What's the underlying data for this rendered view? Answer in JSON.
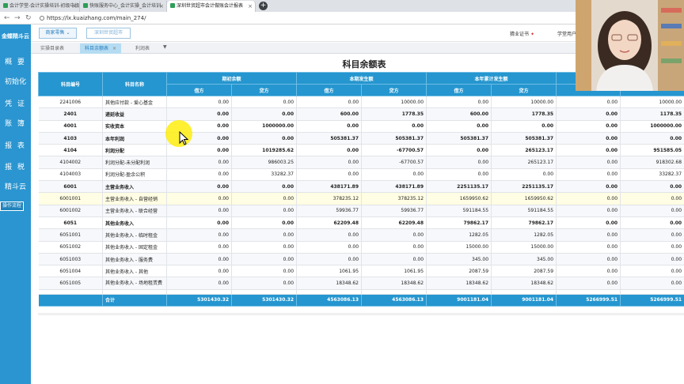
{
  "browser": {
    "tabs": [
      {
        "label": "会计学堂-会计实操培训-初级中级"
      },
      {
        "label": "快账服务中心_会计实操_会计培训"
      },
      {
        "label": "深圳世贸超市会计做账会计报表"
      }
    ],
    "url": "https://lx.kuaizhang.com/main_274/"
  },
  "sidebar": {
    "logo": "金蝶精斗云",
    "items": [
      "概 要",
      "初始化",
      "凭 证",
      "账 簿",
      "报 表",
      "报 税",
      "精斗云"
    ],
    "op_flow": "操作流程"
  },
  "header": {
    "dropdown": "商家零售",
    "company": "深圳世贸超市",
    "cert": "猜业证书",
    "user": "学堂用户"
  },
  "subtabs": [
    {
      "label": "实操目录表"
    },
    {
      "label": "科目余额表"
    },
    {
      "label": "利润表"
    }
  ],
  "report": {
    "title": "科目余额表",
    "headers": {
      "code": "科目编号",
      "name": "科目名称",
      "opening": "期初余额",
      "current": "本期发生额",
      "ytd": "本年累计发生额",
      "debit": "借方",
      "credit": "贷方"
    },
    "rows": [
      {
        "code": "2241006",
        "name": "其他应付款 - 爱心基金",
        "v": [
          "0.00",
          "0.00",
          "0.00",
          "10000.00",
          "0.00",
          "10000.00",
          "0.00",
          "10000.00"
        ]
      },
      {
        "code": "2401",
        "name": "递延收益",
        "v": [
          "0.00",
          "0.00",
          "600.00",
          "1778.35",
          "600.00",
          "1778.35",
          "0.00",
          "1178.35"
        ]
      },
      {
        "code": "4001",
        "name": "实收资本",
        "v": [
          "0.00",
          "1000000.00",
          "0.00",
          "0.00",
          "0.00",
          "0.00",
          "0.00",
          "1000000.00"
        ]
      },
      {
        "code": "4103",
        "name": "本年利润",
        "v": [
          "0.00",
          "0.00",
          "505381.37",
          "505381.37",
          "505381.37",
          "505381.37",
          "0.00",
          "0.00"
        ]
      },
      {
        "code": "4104",
        "name": "利润分配",
        "v": [
          "0.00",
          "1019285.62",
          "0.00",
          "-67700.57",
          "0.00",
          "265123.17",
          "0.00",
          "951585.05"
        ]
      },
      {
        "code": "4104002",
        "name": "利润分配-未分配利润",
        "v": [
          "0.00",
          "986003.25",
          "0.00",
          "-67700.57",
          "0.00",
          "265123.17",
          "0.00",
          "918302.68"
        ]
      },
      {
        "code": "4104003",
        "name": "利润分配-盈余公积",
        "v": [
          "0.00",
          "33282.37",
          "0.00",
          "0.00",
          "0.00",
          "0.00",
          "0.00",
          "33282.37"
        ]
      },
      {
        "code": "6001",
        "name": "主营业务收入",
        "v": [
          "0.00",
          "0.00",
          "438171.89",
          "438171.89",
          "2251135.17",
          "2251135.17",
          "0.00",
          "0.00"
        ]
      },
      {
        "code": "6001001",
        "name": "主营业务收入 - 自营经销",
        "v": [
          "0.00",
          "0.00",
          "378235.12",
          "378235.12",
          "1659950.62",
          "1659950.62",
          "0.00",
          "0.00"
        ]
      },
      {
        "code": "6001002",
        "name": "主营业务收入 - 联合经营",
        "v": [
          "0.00",
          "0.00",
          "59936.77",
          "59936.77",
          "591184.55",
          "591184.55",
          "0.00",
          "0.00"
        ]
      },
      {
        "code": "6051",
        "name": "其他业务收入",
        "v": [
          "0.00",
          "0.00",
          "62209.48",
          "62209.48",
          "79862.17",
          "79862.17",
          "0.00",
          "0.00"
        ]
      },
      {
        "code": "6051001",
        "name": "其他业务收入 - 临时租金",
        "v": [
          "0.00",
          "0.00",
          "0.00",
          "0.00",
          "1282.05",
          "1282.05",
          "0.00",
          "0.00"
        ]
      },
      {
        "code": "6051002",
        "name": "其他业务收入 - 固定租金",
        "v": [
          "0.00",
          "0.00",
          "0.00",
          "0.00",
          "15000.00",
          "15000.00",
          "0.00",
          "0.00"
        ]
      },
      {
        "code": "6051003",
        "name": "其他业务收入 - 服务费",
        "v": [
          "0.00",
          "0.00",
          "0.00",
          "0.00",
          "345.00",
          "345.00",
          "0.00",
          "0.00"
        ]
      },
      {
        "code": "6051004",
        "name": "其他业务收入 - 其他",
        "v": [
          "0.00",
          "0.00",
          "1061.95",
          "1061.95",
          "2087.59",
          "2087.59",
          "0.00",
          "0.00"
        ]
      },
      {
        "code": "6051005",
        "name": "其他业务收入 - 场地租赁费",
        "v": [
          "0.00",
          "0.00",
          "18348.62",
          "18348.62",
          "18348.62",
          "18348.62",
          "0.00",
          "0.00"
        ]
      }
    ],
    "total": {
      "label": "合计",
      "v": [
        "5301430.32",
        "5301430.32",
        "4563086.13",
        "4563086.13",
        "9001181.04",
        "9001181.04",
        "5266999.51",
        "5266999.51"
      ]
    }
  }
}
